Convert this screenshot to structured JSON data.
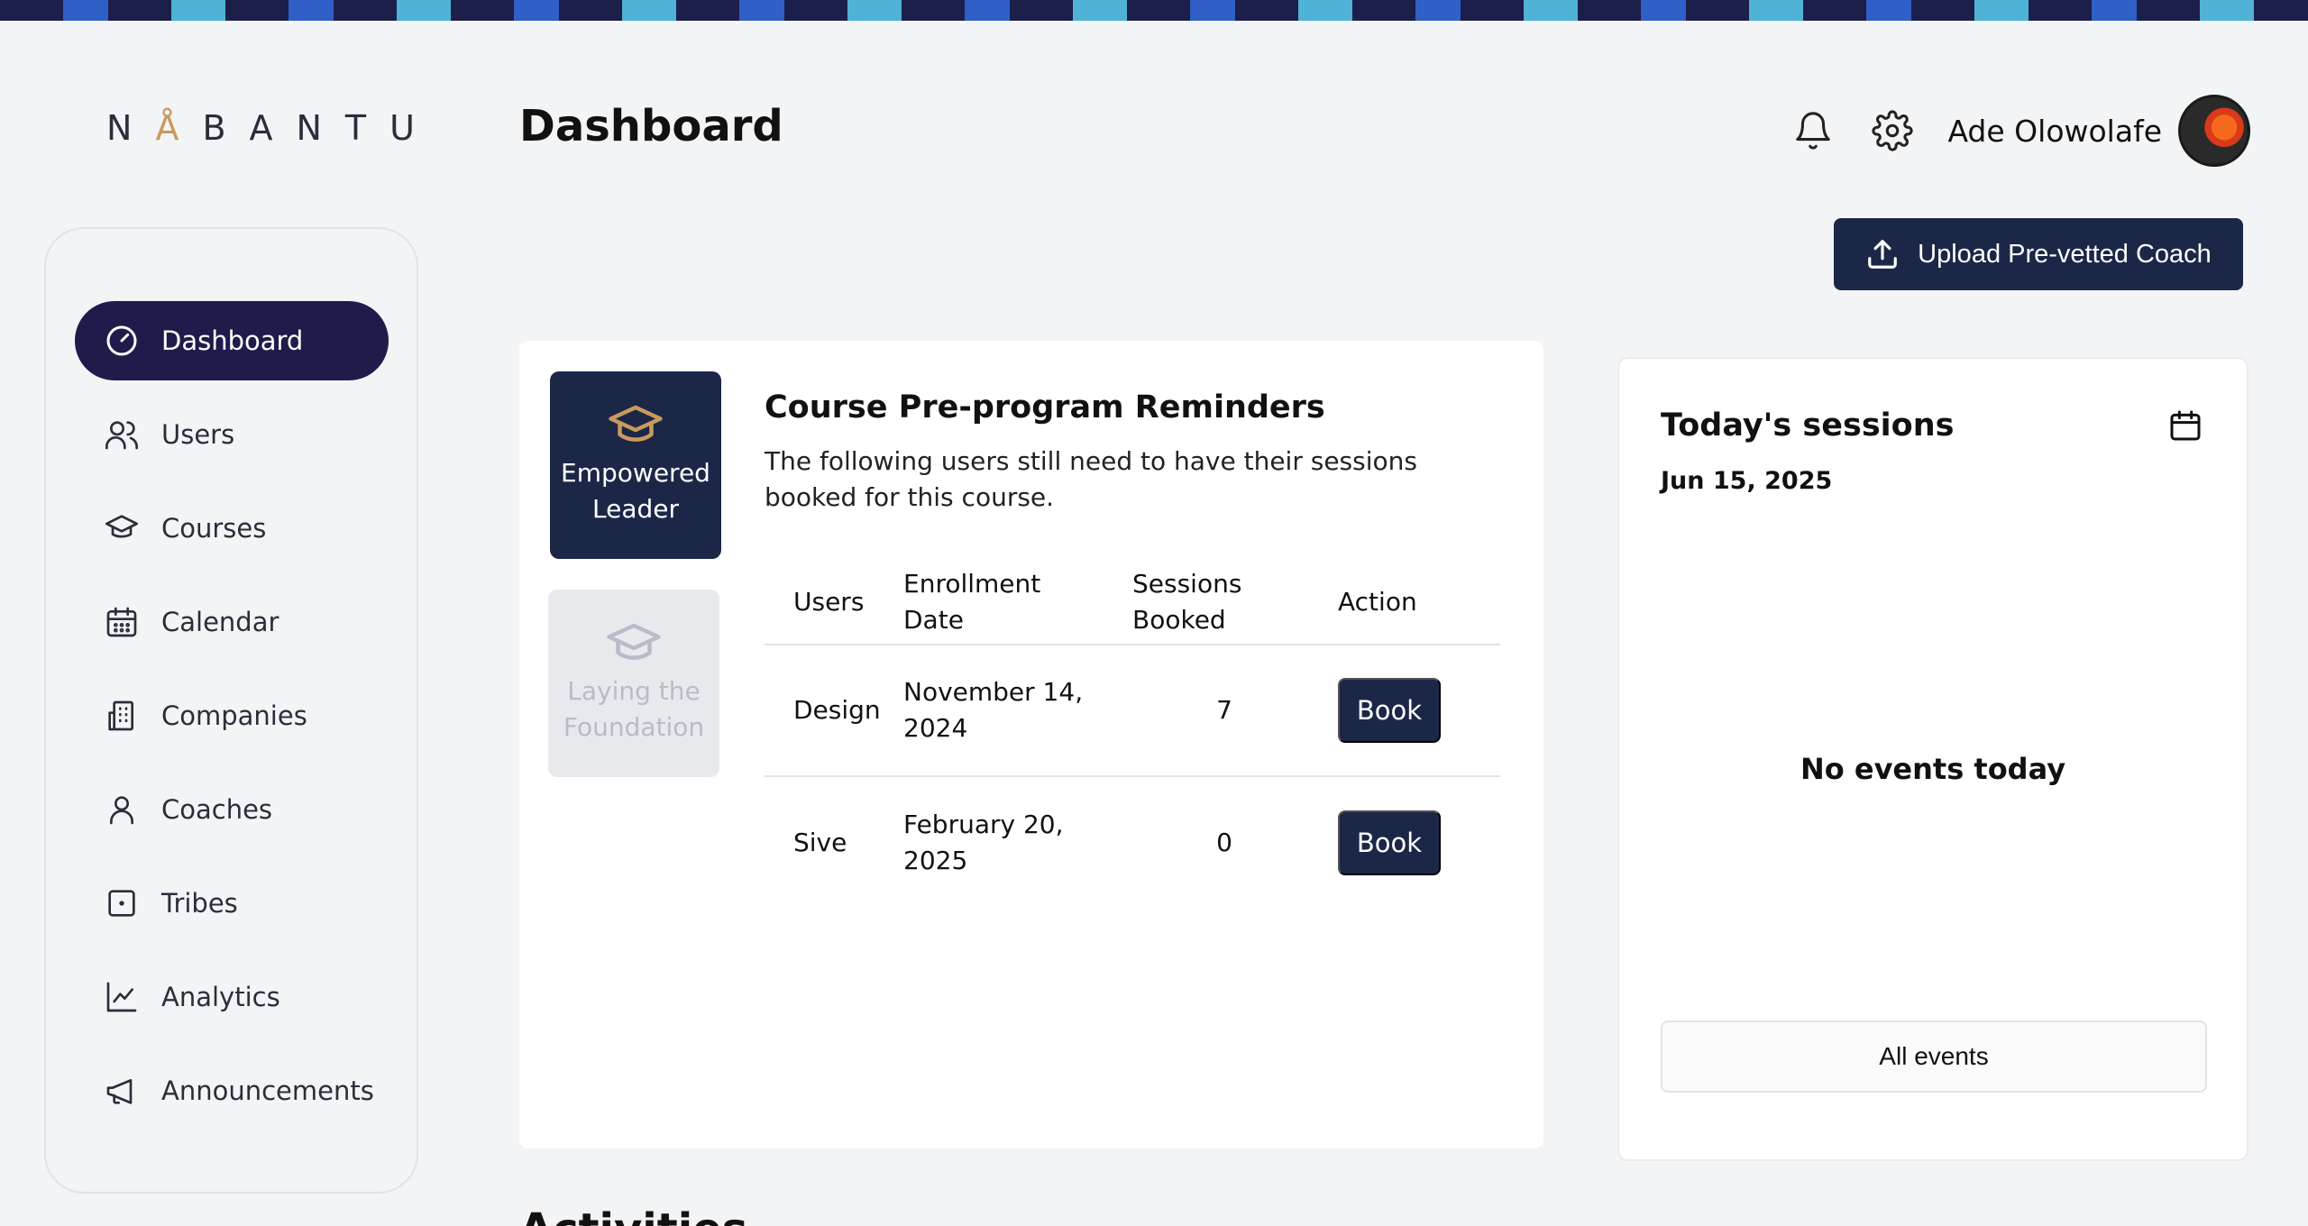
{
  "brand": {
    "logo_left": "N",
    "logo_accent": "Å",
    "logo_right": "BANTU"
  },
  "header": {
    "title": "Dashboard",
    "user_name": "Ade Olowolafe",
    "upload_label": "Upload Pre-vetted Coach"
  },
  "sidebar": {
    "items": [
      {
        "label": "Dashboard",
        "icon": "gauge-icon",
        "active": true
      },
      {
        "label": "Users",
        "icon": "users-icon"
      },
      {
        "label": "Courses",
        "icon": "graduation-cap-icon"
      },
      {
        "label": "Calendar",
        "icon": "calendar-icon"
      },
      {
        "label": "Companies",
        "icon": "building-icon"
      },
      {
        "label": "Coaches",
        "icon": "user-icon"
      },
      {
        "label": "Tribes",
        "icon": "square-dot-icon"
      },
      {
        "label": "Analytics",
        "icon": "line-chart-icon"
      },
      {
        "label": "Announcements",
        "icon": "megaphone-icon"
      }
    ]
  },
  "courses": {
    "tiles": [
      {
        "label_line1": "Empowered",
        "label_line2": "Leader",
        "active": true
      },
      {
        "label_line1": "Laying the",
        "label_line2": "Foundation",
        "active": false
      }
    ]
  },
  "reminders": {
    "title": "Course Pre-program Reminders",
    "description": "The following users still need to have their sessions booked for this course.",
    "columns": {
      "users": "Users",
      "enrollment_line1": "Enrollment",
      "enrollment_line2": "Date",
      "sessions_line1": "Sessions",
      "sessions_line2": "Booked",
      "action": "Action"
    },
    "rows": [
      {
        "user": "Design",
        "date_line1": "November 14,",
        "date_line2": "2024",
        "sessions": "7",
        "action": "Book"
      },
      {
        "user": "Sive",
        "date_line1": "February 20,",
        "date_line2": "2025",
        "sessions": "0",
        "action": "Book"
      }
    ]
  },
  "sessions": {
    "title": "Today's sessions",
    "date": "Jun 15, 2025",
    "empty_text": "No events today",
    "all_events_label": "All events"
  },
  "activities": {
    "heading": "Activities"
  },
  "colors": {
    "primary": "#1c2748",
    "nav_active": "#1f1b4b",
    "accent_gold": "#c99a5b",
    "background": "#f3f4f6"
  }
}
